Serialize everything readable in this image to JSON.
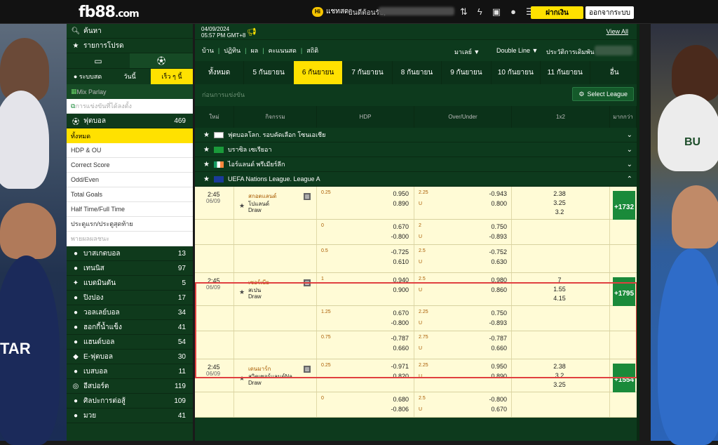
{
  "header": {
    "logo": "fb88",
    "logo_domain": ".com",
    "chat_icon": "Hi",
    "chat_label": "แชทสด",
    "welcome": "ยินดีต้อนรับ,",
    "deposit_label": "ฝากเงิน",
    "logout_label": "ออกจากระบบ"
  },
  "sidebar": {
    "search": "ค้นหา",
    "favorites": "รายการโปรด",
    "tabs": [
      "● ระบบสด",
      "วันนี้",
      "เร็ว ๆ นี้"
    ],
    "mix_parlay": "Mix Parlay",
    "live_streaming": "การแข่งขันที่ได้ลงตั้ง",
    "football": {
      "label": "ฟุตบอล",
      "count": "469"
    },
    "sub_items": [
      "ทั้งหมด",
      "HDP & OU",
      "Correct Score",
      "Odd/Even",
      "Total Goals",
      "Half Time/Full Time",
      "ประตูแรก/ประตูสุดท้าย",
      "พายผลผลชนะ"
    ],
    "sports": [
      {
        "label": "บาสเกตบอล",
        "count": "13"
      },
      {
        "label": "เทนนิส",
        "count": "97"
      },
      {
        "label": "แบดมินตัน",
        "count": "5"
      },
      {
        "label": "ปิงปอง",
        "count": "17"
      },
      {
        "label": "วอลเลย์บอล",
        "count": "34"
      },
      {
        "label": "ฮอกกี้น้ำแข็ง",
        "count": "41"
      },
      {
        "label": "แฮนด์บอล",
        "count": "54"
      },
      {
        "label": "E-ฟุตบอล",
        "count": "30"
      },
      {
        "label": "เบสบอล",
        "count": "11"
      },
      {
        "label": "อีสปอร์ต",
        "count": "119"
      },
      {
        "label": "ศิลปะการต่อสู้",
        "count": "109"
      },
      {
        "label": "มวย",
        "count": "41"
      }
    ]
  },
  "main": {
    "date": "04/09/2024",
    "time": "05:57 PM GMT+8",
    "view_all": "View All",
    "nav": [
      "บ้าน",
      "ปฏิทิน",
      "ผล",
      "คะแนนสด",
      "สถิติ"
    ],
    "nav_right": [
      "มาเลย์ ▼",
      "Double Line ▼",
      "ประวัติการเดิมพัน"
    ],
    "days": [
      "ทั้งหมด",
      "5 กันยายน",
      "6 กันยายน",
      "7 กันยายน",
      "8 กันยายน",
      "9 กันยายน",
      "10 กันยายน",
      "11 กันยายน",
      "อื่น"
    ],
    "upcoming": "ก่อนการแข่งขัน",
    "select_league": "Select League",
    "columns": [
      "ใหม่",
      "กิจกรรม",
      "HDP",
      "Over/Under",
      "1x2",
      "มากกว่า"
    ],
    "leagues": [
      {
        "name": "ฟุตบอลโลก. รอบคัดเลือก โซนเอเชีย"
      },
      {
        "name": "บราซิล เซเรียอา"
      },
      {
        "name": "ไอร์แลนด์ พรีเมียร์ลีก"
      },
      {
        "name": "UEFA Nations League. League A"
      }
    ],
    "matches": [
      {
        "time": "2:45",
        "date": "06/09",
        "home": "สกอตแลนด์",
        "away": "โปแลนด์",
        "draw": "Draw",
        "more": "+1732",
        "rows": [
          {
            "hdp_line": "0.25",
            "hdp_home": "0.950",
            "hdp_away": "0.890",
            "ou_line": "2.25",
            "ou_over": "-0.943",
            "ou_u": "U",
            "ou_under": "0.800",
            "x1": "2.38",
            "x2": "3.25",
            "x3": "3.2"
          },
          {
            "hdp_line": "0",
            "hdp_home": "0.670",
            "hdp_away": "-0.800",
            "ou_line": "2",
            "ou_over": "0.750",
            "ou_u": "U",
            "ou_under": "-0.893"
          },
          {
            "hdp_line": "0.5",
            "hdp_home": "-0.725",
            "hdp_away": "0.610",
            "ou_line": "2.5",
            "ou_over": "-0.752",
            "ou_u": "U",
            "ou_under": "0.630"
          }
        ]
      },
      {
        "time": "2:45",
        "date": "06/09",
        "home": "เซอร์เบีย",
        "away": "สเปน",
        "draw": "Draw",
        "more": "+1795",
        "rows": [
          {
            "hdp_line": "1",
            "hdp_home": "0.940",
            "hdp_away": "0.900",
            "ou_line": "2.5",
            "ou_over": "0.980",
            "ou_u": "U",
            "ou_under": "0.860",
            "x1": "7",
            "x2": "1.55",
            "x3": "4.15"
          },
          {
            "hdp_line": "1.25",
            "hdp_home": "0.670",
            "hdp_away": "-0.800",
            "ou_line": "2.25",
            "ou_over": "0.750",
            "ou_u": "U",
            "ou_under": "-0.893"
          },
          {
            "hdp_line": "0.75",
            "hdp_home": "-0.787",
            "hdp_away": "0.660",
            "ou_line": "2.75",
            "ou_over": "-0.787",
            "ou_u": "U",
            "ou_under": "0.660"
          }
        ]
      },
      {
        "time": "2:45",
        "date": "06/09",
        "home": "เดนมาร์ก",
        "away": "สวิตเซอร์แลนด์Na...",
        "draw": "Draw",
        "more": "+1554",
        "rows": [
          {
            "hdp_line": "0.25",
            "hdp_home": "-0.971",
            "hdp_away": "0.820",
            "ou_line": "2.25",
            "ou_over": "0.950",
            "ou_u": "U",
            "ou_under": "0.890",
            "x1": "2.38",
            "x2": "3.2",
            "x3": "3.25"
          },
          {
            "hdp_line": "0",
            "hdp_home": "0.680",
            "hdp_away": "-0.806",
            "ou_line": "2.5",
            "ou_over": "-0.800",
            "ou_u": "U",
            "ou_under": "0.670"
          }
        ]
      }
    ]
  }
}
